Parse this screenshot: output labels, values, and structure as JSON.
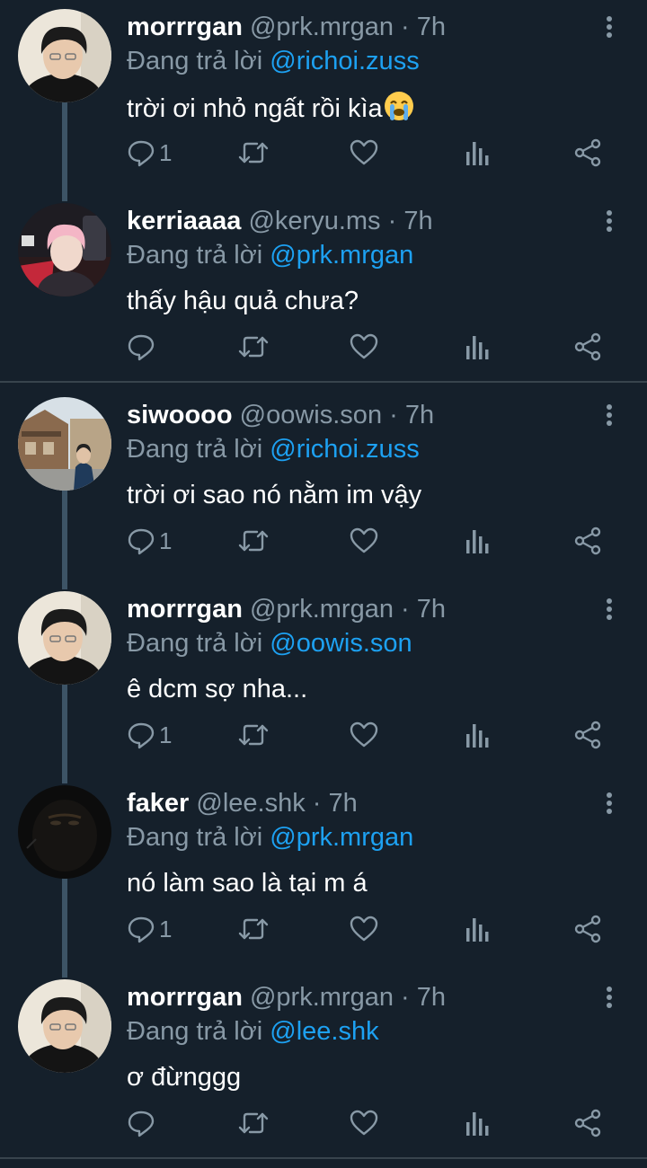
{
  "colors": {
    "background": "#15202b",
    "primary_text": "#ffffff",
    "secondary_text": "#8899a6",
    "link": "#1da1f2",
    "thread_line": "#3d5466",
    "divider": "#38444d"
  },
  "reply_prefix": "Đang trả lời",
  "dot": "·",
  "tweets": [
    {
      "display_name": "morrrgan",
      "handle": "@prk.mrgan",
      "time": "7h",
      "reply_to": "@richoi.zuss",
      "text": "trời ơi nhỏ ngất rồi kìa",
      "emoji": "loudly-crying-face",
      "reply_count": "1",
      "avatar": "dark-haired-person-glasses"
    },
    {
      "display_name": "kerriaaaa",
      "handle": "@keryu.ms",
      "time": "7h",
      "reply_to": "@prk.mrgan",
      "text": "thấy hậu quả chưa?",
      "reply_count": "",
      "avatar": "pink-haired-person-gaming-chair"
    },
    {
      "display_name": "siwoooo",
      "handle": "@oowis.son",
      "time": "7h",
      "reply_to": "@richoi.zuss",
      "text": "trời ơi sao nó nằm im vậy",
      "reply_count": "1",
      "avatar": "person-street-houses"
    },
    {
      "display_name": "morrrgan",
      "handle": "@prk.mrgan",
      "time": "7h",
      "reply_to": "@oowis.son",
      "text": "ê dcm sợ nha...",
      "reply_count": "1",
      "avatar": "dark-haired-person-glasses"
    },
    {
      "display_name": "faker",
      "handle": "@lee.shk",
      "time": "7h",
      "reply_to": "@prk.mrgan",
      "text": "nó làm sao là tại m á",
      "reply_count": "1",
      "avatar": "dark-silhouette"
    },
    {
      "display_name": "morrrgan",
      "handle": "@prk.mrgan",
      "time": "7h",
      "reply_to": "@lee.shk",
      "text": "ơ đừnggg",
      "reply_count": "",
      "avatar": "dark-haired-person-glasses"
    }
  ]
}
